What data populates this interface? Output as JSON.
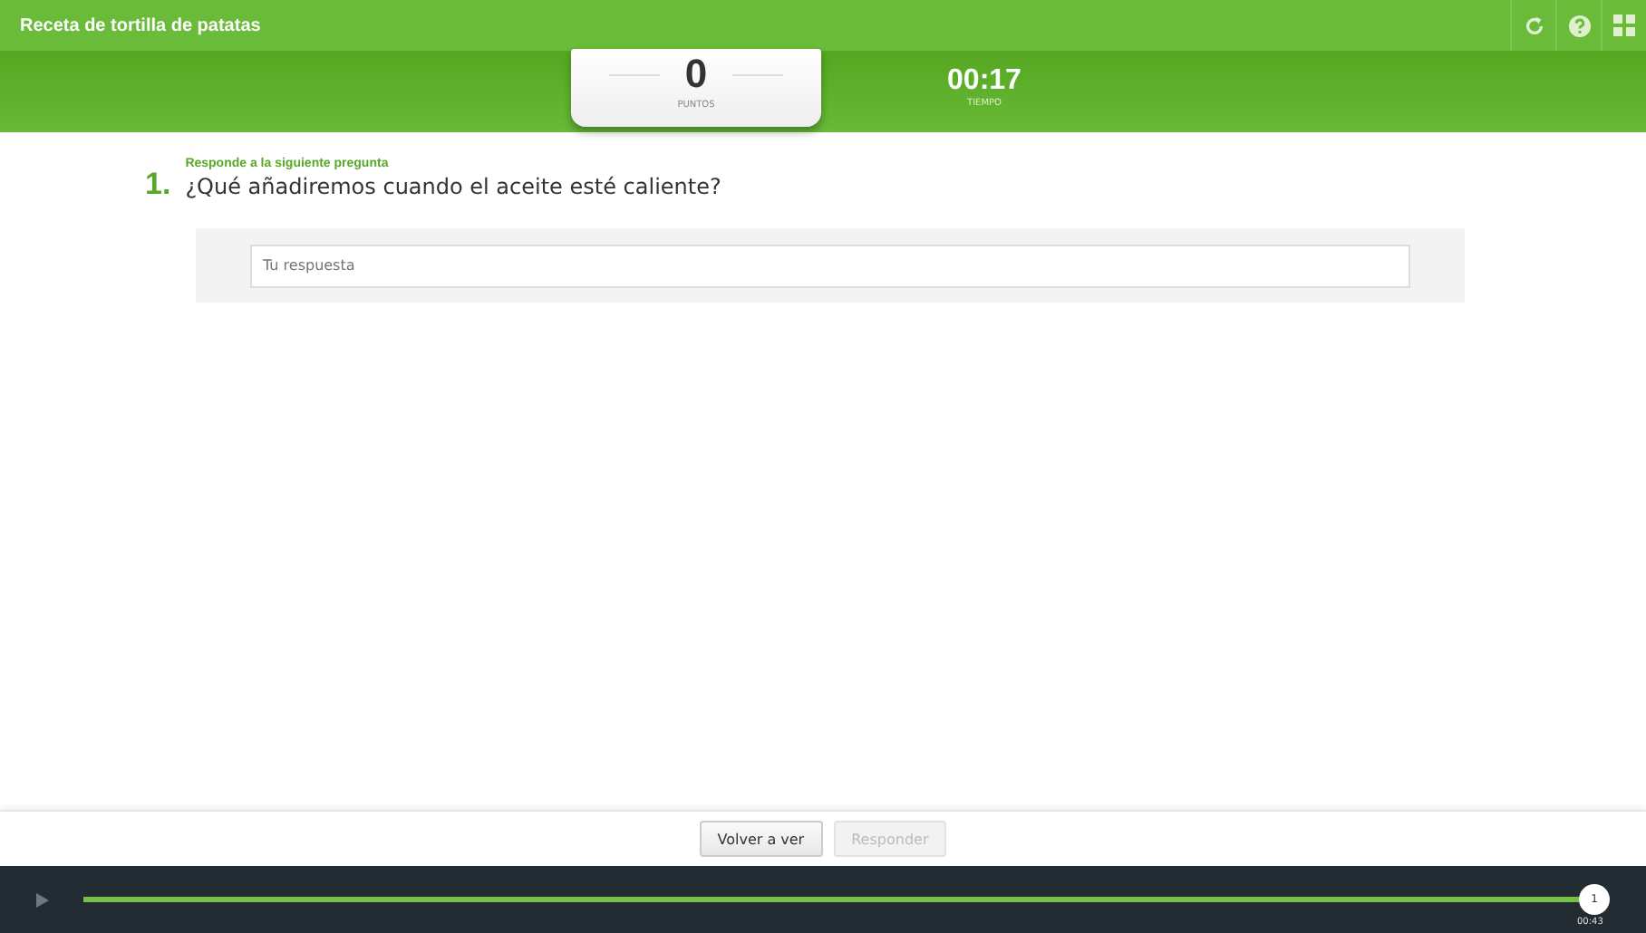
{
  "window": {
    "title": "Receta de tortilla de patatas"
  },
  "score": {
    "value": "0",
    "label": "PUNTOS"
  },
  "timer": {
    "value": "00:17",
    "label": "TIEMPO"
  },
  "question": {
    "number": "1.",
    "instruction": "Responde a la siguiente pregunta",
    "text": "¿Qué añadiremos cuando el aceite esté caliente?",
    "answer": {
      "placeholder": "Tu respuesta"
    }
  },
  "buttons": [
    {
      "label": "Volver a ver",
      "disabled": false
    },
    {
      "label": "Responder",
      "disabled": true
    }
  ],
  "player": {
    "level": 1,
    "marker": "1",
    "time": "00:43"
  }
}
